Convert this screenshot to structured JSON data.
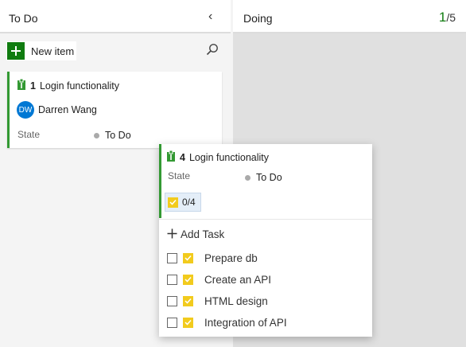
{
  "columns": {
    "todo": {
      "title": "To Do",
      "collapse_glyph": "‹"
    },
    "doing": {
      "title": "Doing",
      "wip_current": "1",
      "wip_limit": "/5"
    }
  },
  "toolbar": {
    "new_item_label": "New item"
  },
  "cards": [
    {
      "id": "1",
      "title": "Login functionality",
      "owner_initials": "DW",
      "owner_name": "Darren Wang",
      "state_label": "State",
      "state_value": "To Do"
    }
  ],
  "popup": {
    "id": "4",
    "title": "Login functionality",
    "state_label": "State",
    "state_value": "To Do",
    "child_count": "0/4",
    "add_task_label": "Add Task",
    "tasks": [
      {
        "label": "Prepare db"
      },
      {
        "label": "Create an API"
      },
      {
        "label": "HTML design"
      },
      {
        "label": "Integration of API"
      }
    ]
  },
  "colors": {
    "accent_green": "#107c10",
    "card_border": "#339933",
    "avatar": "#0078d4",
    "task_icon": "#f2cb1d",
    "state_dot": "#aaaaaa"
  },
  "icons": {
    "collapse": "chevron-left-icon",
    "add": "plus-icon",
    "search": "search-icon",
    "work_item": "clipboard-icon",
    "task": "task-check-icon"
  }
}
